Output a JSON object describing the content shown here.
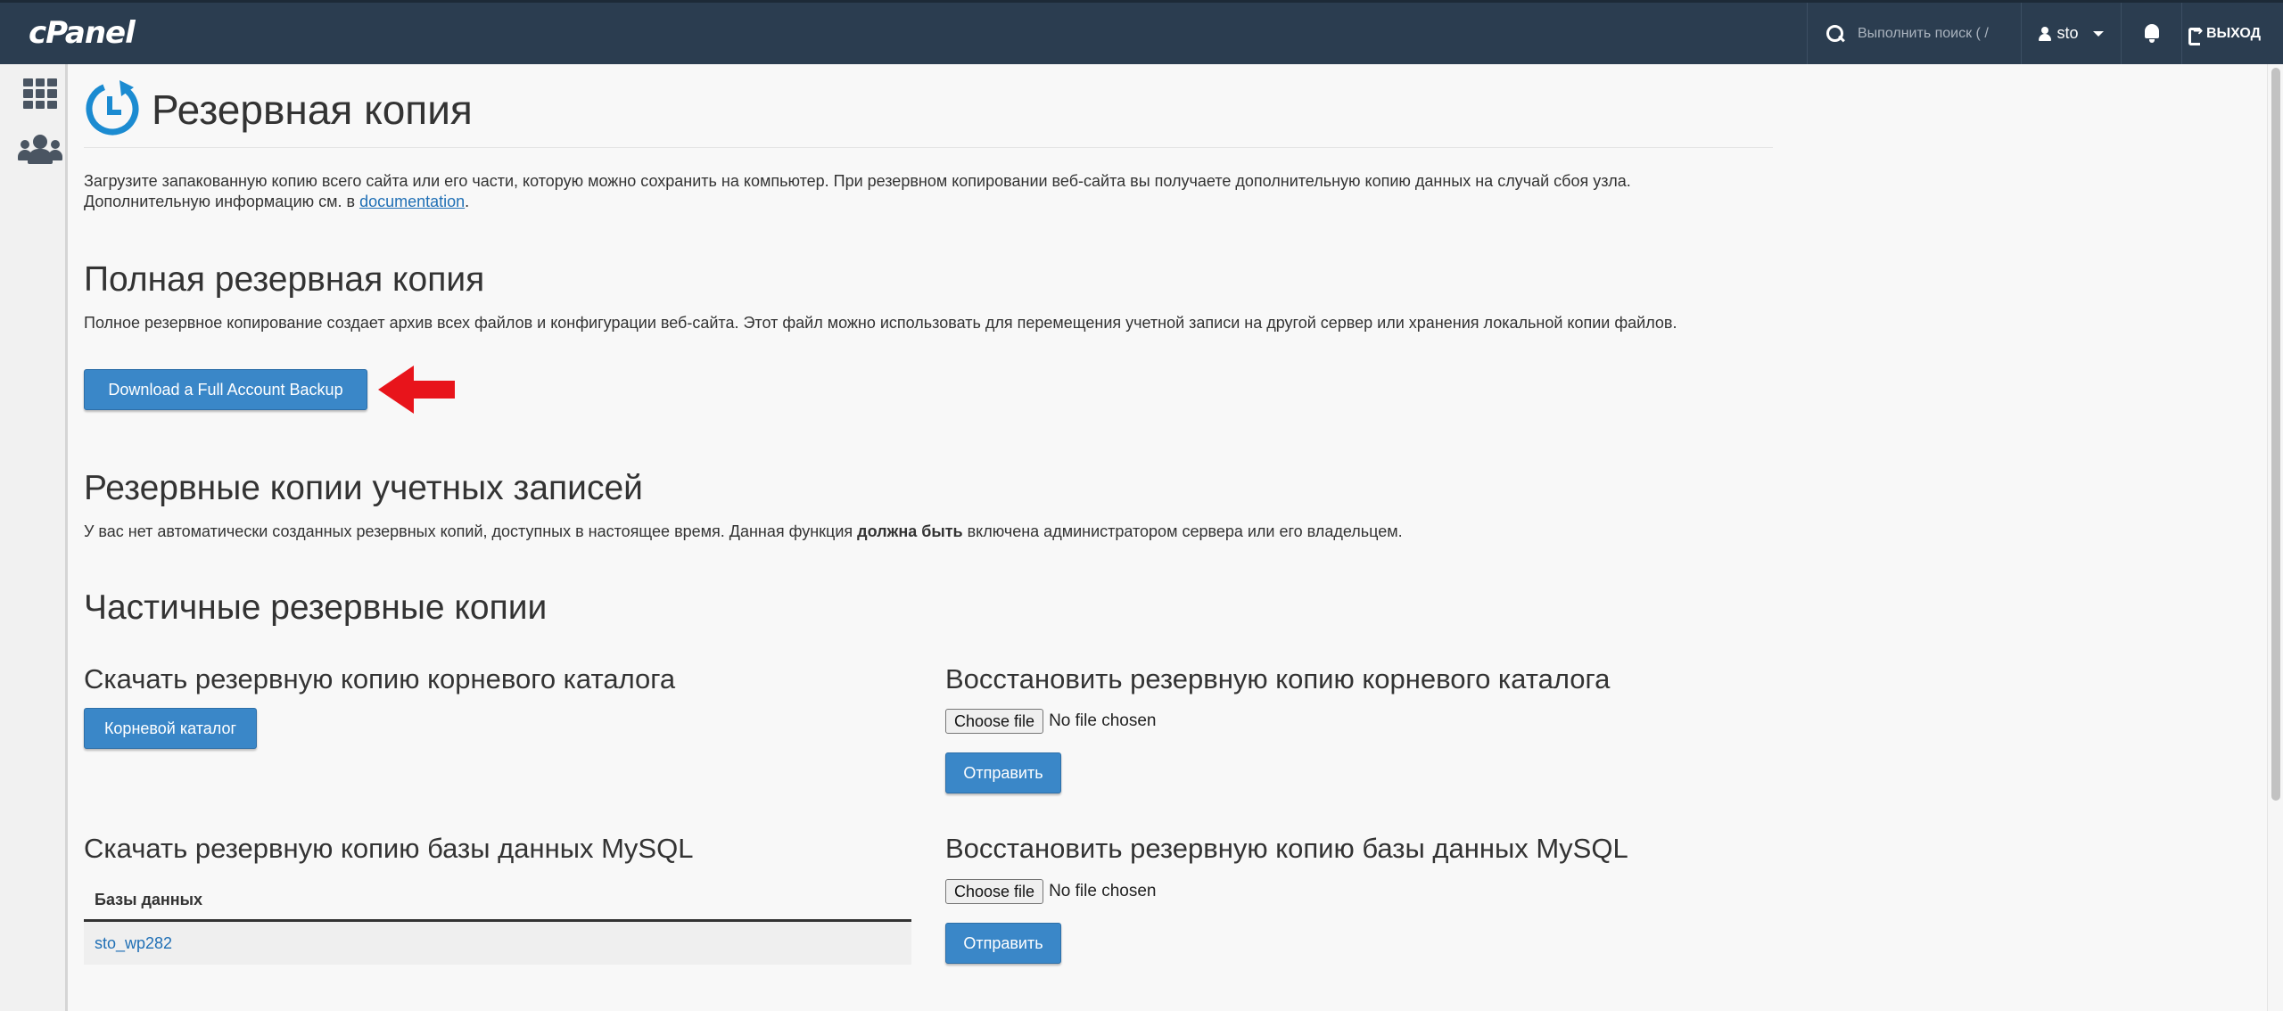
{
  "topbar": {
    "logo": "cPanel",
    "search_placeholder": "Выполнить поиск ( /",
    "user": "sto",
    "logout": "ВЫХОД"
  },
  "sidebar": {
    "items": [
      {
        "name": "apps-grid-icon"
      },
      {
        "name": "users-icon"
      }
    ]
  },
  "page": {
    "title": "Резервная копия",
    "intro_text": "Загрузите запакованную копию всего сайта или его части, которую можно сохранить на компьютер. При резервном копировании веб-сайта вы получаете дополнительную копию данных на случай сбоя узла.",
    "intro_more": "Дополнительную информацию см. в ",
    "intro_link": "documentation",
    "intro_end": "."
  },
  "full_backup": {
    "heading": "Полная резервная копия",
    "description": "Полное резервное копирование создает архив всех файлов и конфигурации веб-сайта. Этот файл можно использовать для перемещения учетной записи на другой сервер или хранения локальной копии файлов.",
    "button": "Download a Full Account Backup"
  },
  "account_backups": {
    "heading": "Резервные копии учетных записей",
    "desc_before": "У вас нет автоматически созданных резервных копий, доступных в настоящее время. Данная функция ",
    "desc_bold": "должна быть",
    "desc_after": " включена администратором сервера или его владельцем."
  },
  "partial": {
    "heading": "Частичные резервные копии",
    "home_download_heading": "Скачать резервную копию корневого каталога",
    "home_download_button": "Корневой каталог",
    "home_restore_heading": "Восстановить резервную копию корневого каталога",
    "choose_file": "Choose file",
    "no_file": "No file chosen",
    "submit": "Отправить",
    "mysql_download_heading": "Скачать резервную копию базы данных MySQL",
    "mysql_restore_heading": "Восстановить резервную копию базы данных MySQL",
    "db_table_header": "Базы данных",
    "databases": [
      "sto_wp282"
    ]
  }
}
